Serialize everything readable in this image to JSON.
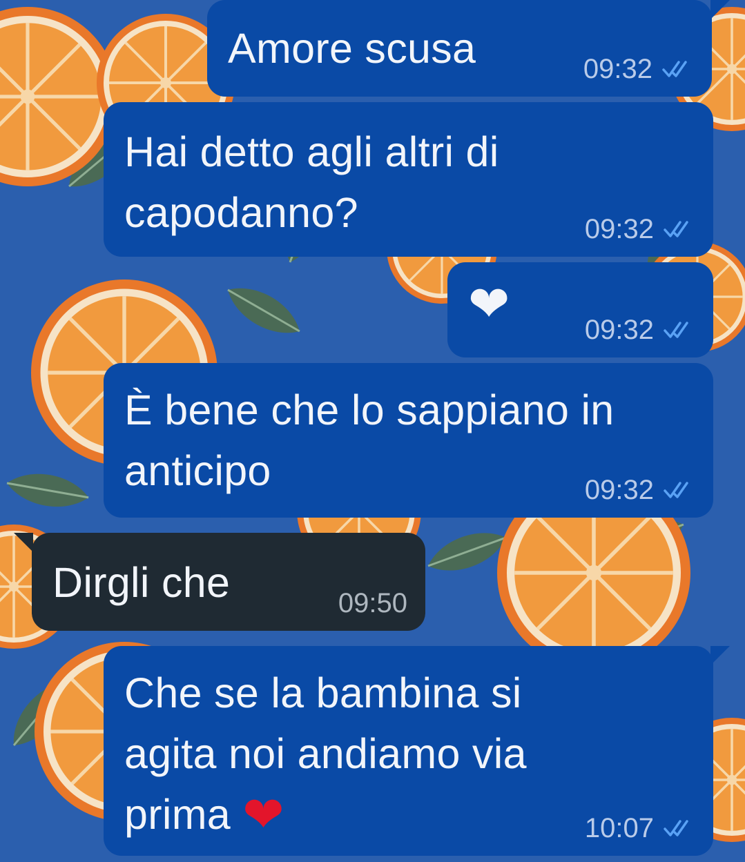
{
  "messages": [
    {
      "direction": "outgoing",
      "text": "Amore scusa",
      "time": "09:32",
      "status": "read"
    },
    {
      "direction": "outgoing",
      "text": "Hai detto agli altri di capodanno?",
      "time": "09:32",
      "status": "read"
    },
    {
      "direction": "outgoing",
      "text": "❤",
      "time": "09:32",
      "status": "read"
    },
    {
      "direction": "outgoing",
      "text": "È bene che lo sappiano in anticipo",
      "time": "09:32",
      "status": "read"
    },
    {
      "direction": "incoming",
      "text": "Dirgli che",
      "time": "09:50"
    },
    {
      "direction": "outgoing",
      "text": "Che se la bambina si agita noi andiamo via prima",
      "emoji": "❤",
      "time": "10:07",
      "status": "read"
    }
  ],
  "colors": {
    "outgoing_bubble": "#0a4aa6",
    "incoming_bubble": "#1f2a33",
    "read_ticks": "#5aa2f5",
    "wallpaper_background": "#2b5fae",
    "wallpaper_orange": "#f08a2c"
  },
  "icons": {
    "read_status": "double-check-icon",
    "heart": "red-heart-emoji"
  }
}
